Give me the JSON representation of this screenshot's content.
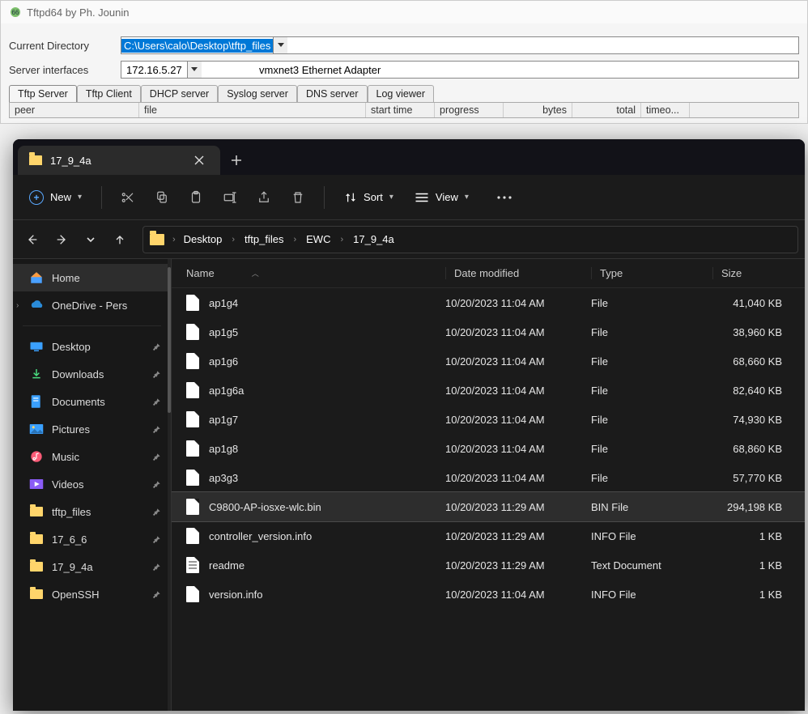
{
  "tftpd": {
    "title": "Tftpd64 by Ph. Jounin",
    "current_directory_label": "Current Directory",
    "current_directory_value": "C:\\Users\\calo\\Desktop\\tftp_files",
    "server_interfaces_label": "Server interfaces",
    "server_interface_ip": "172.16.5.27",
    "server_interface_adapter": "vmxnet3 Ethernet Adapter",
    "tabs": [
      "Tftp Server",
      "Tftp Client",
      "DHCP server",
      "Syslog server",
      "DNS server",
      "Log viewer"
    ],
    "columns": {
      "peer": "peer",
      "file": "file",
      "start_time": "start time",
      "progress": "progress",
      "bytes": "bytes",
      "total": "total",
      "timeo": "timeo..."
    }
  },
  "explorer": {
    "tab_title": "17_9_4a",
    "toolbar": {
      "new_label": "New",
      "sort_label": "Sort",
      "view_label": "View"
    },
    "breadcrumb": [
      "Desktop",
      "tftp_files",
      "EWC",
      "17_9_4a"
    ],
    "sidebar": {
      "home": "Home",
      "onedrive": "OneDrive - Pers",
      "items": [
        {
          "label": "Desktop",
          "icon": "desktop"
        },
        {
          "label": "Downloads",
          "icon": "downloads"
        },
        {
          "label": "Documents",
          "icon": "documents"
        },
        {
          "label": "Pictures",
          "icon": "pictures"
        },
        {
          "label": "Music",
          "icon": "music"
        },
        {
          "label": "Videos",
          "icon": "videos"
        },
        {
          "label": "tftp_files",
          "icon": "folder"
        },
        {
          "label": "17_6_6",
          "icon": "folder"
        },
        {
          "label": "17_9_4a",
          "icon": "folder"
        },
        {
          "label": "OpenSSH",
          "icon": "folder"
        }
      ]
    },
    "columns": {
      "name": "Name",
      "modified": "Date modified",
      "type": "Type",
      "size": "Size"
    },
    "files": [
      {
        "name": "ap1g4",
        "modified": "10/20/2023 11:04 AM",
        "type": "File",
        "size": "41,040 KB"
      },
      {
        "name": "ap1g5",
        "modified": "10/20/2023 11:04 AM",
        "type": "File",
        "size": "38,960 KB"
      },
      {
        "name": "ap1g6",
        "modified": "10/20/2023 11:04 AM",
        "type": "File",
        "size": "68,660 KB"
      },
      {
        "name": "ap1g6a",
        "modified": "10/20/2023 11:04 AM",
        "type": "File",
        "size": "82,640 KB"
      },
      {
        "name": "ap1g7",
        "modified": "10/20/2023 11:04 AM",
        "type": "File",
        "size": "74,930 KB"
      },
      {
        "name": "ap1g8",
        "modified": "10/20/2023 11:04 AM",
        "type": "File",
        "size": "68,860 KB"
      },
      {
        "name": "ap3g3",
        "modified": "10/20/2023 11:04 AM",
        "type": "File",
        "size": "57,770 KB"
      },
      {
        "name": "C9800-AP-iosxe-wlc.bin",
        "modified": "10/20/2023 11:29 AM",
        "type": "BIN File",
        "size": "294,198 KB",
        "selected": true
      },
      {
        "name": "controller_version.info",
        "modified": "10/20/2023 11:29 AM",
        "type": "INFO File",
        "size": "1 KB"
      },
      {
        "name": "readme",
        "modified": "10/20/2023 11:29 AM",
        "type": "Text Document",
        "size": "1 KB",
        "text": true
      },
      {
        "name": "version.info",
        "modified": "10/20/2023 11:04 AM",
        "type": "INFO File",
        "size": "1 KB"
      }
    ]
  }
}
